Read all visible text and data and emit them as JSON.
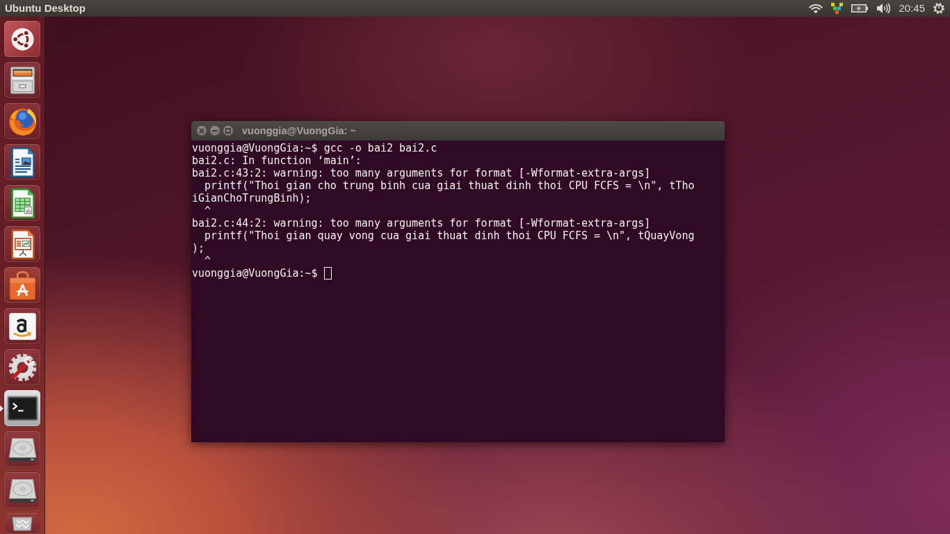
{
  "top_panel": {
    "title": "Ubuntu Desktop",
    "indicators": [
      {
        "kind": "network"
      },
      {
        "kind": "tray"
      },
      {
        "kind": "battery"
      },
      {
        "kind": "sound"
      },
      {
        "kind": "clock",
        "text": "20:45"
      },
      {
        "kind": "session"
      }
    ]
  },
  "launcher": {
    "items": [
      {
        "kind": "dash",
        "running": false
      },
      {
        "kind": "files",
        "running": false
      },
      {
        "kind": "firefox",
        "running": false
      },
      {
        "kind": "writer",
        "running": false
      },
      {
        "kind": "calc",
        "running": false
      },
      {
        "kind": "impress",
        "running": false
      },
      {
        "kind": "software",
        "running": false
      },
      {
        "kind": "amazon",
        "running": false
      },
      {
        "kind": "settings",
        "running": false
      },
      {
        "kind": "terminal",
        "running": true
      },
      {
        "kind": "drive",
        "running": false
      },
      {
        "kind": "drive",
        "running": false
      },
      {
        "kind": "trash",
        "running": false
      }
    ]
  },
  "terminal_window": {
    "title": "vuonggia@VuongGia: ~",
    "focused": false,
    "lines": [
      "vuonggia@VuongGia:~$ gcc -o bai2 bai2.c",
      "bai2.c: In function ‘main’:",
      "bai2.c:43:2: warning: too many arguments for format [-Wformat-extra-args]",
      "  printf(\"Thoi gian cho trung binh cua giai thuat dinh thoi CPU FCFS = \\n\", tTho",
      "iGianChoTrungBinh);",
      "  ^",
      "bai2.c:44:2: warning: too many arguments for format [-Wformat-extra-args]",
      "  printf(\"Thoi gian quay vong cua giai thuat dinh thoi CPU FCFS = \\n\", tQuayVong",
      ");",
      "  ^"
    ],
    "prompt": "vuonggia@VuongGia:~$"
  }
}
